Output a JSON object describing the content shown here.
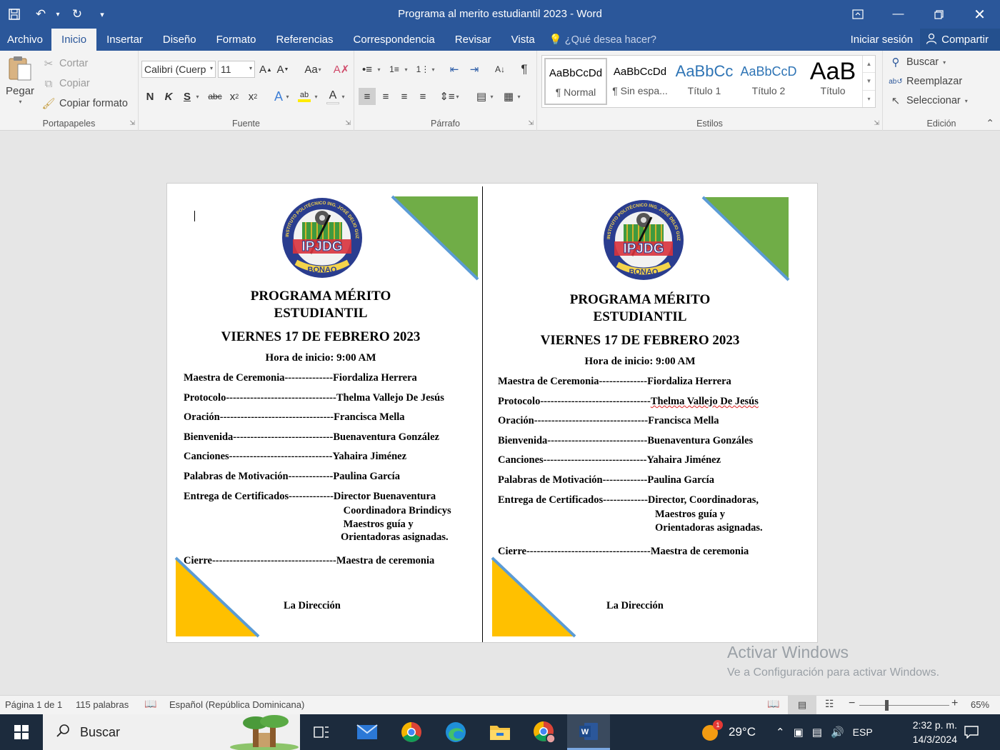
{
  "window": {
    "title": "Programa al merito estudiantil 2023 - Word"
  },
  "tabs": [
    "Archivo",
    "Inicio",
    "Insertar",
    "Diseño",
    "Formato",
    "Referencias",
    "Correspondencia",
    "Revisar",
    "Vista"
  ],
  "active_tab": "Inicio",
  "tell_me": "¿Qué desea hacer?",
  "sign_in": "Iniciar sesión",
  "share": "Compartir",
  "clipboard": {
    "label": "Portapapeles",
    "paste": "Pegar",
    "cut": "Cortar",
    "copy": "Copiar",
    "format_painter": "Copiar formato"
  },
  "font": {
    "label": "Fuente",
    "name": "Calibri (Cuerp",
    "size": "11"
  },
  "paragraph": {
    "label": "Párrafo"
  },
  "styles": {
    "label": "Estilos",
    "items": [
      {
        "sample": "AaBbCcDd",
        "name": "¶ Normal"
      },
      {
        "sample": "AaBbCcDd",
        "name": "¶ Sin espa..."
      },
      {
        "sample": "AaBbCc",
        "name": "Título 1"
      },
      {
        "sample": "AaBbCcD",
        "name": "Título 2"
      },
      {
        "sample": "AaB",
        "name": "Título"
      }
    ]
  },
  "editing": {
    "label": "Edición",
    "find": "Buscar",
    "replace": "Reemplazar",
    "select": "Seleccionar"
  },
  "document": {
    "left": {
      "title_line1": "PROGRAMA MÉRITO",
      "title_line2": "ESTUDIANTIL",
      "date": "VIERNES 17 DE FEBRERO 2023",
      "start_time": "Hora de inicio: 9:00 AM",
      "rows": [
        {
          "role": "Maestra de Ceremonia--------------",
          "person": "Fiordaliza Herrera"
        },
        {
          "role": "Protocolo--------------------------------",
          "person": "Thelma Vallejo De Jesús"
        },
        {
          "role": "Oración---------------------------------",
          "person": "Francisca Mella"
        },
        {
          "role": "Bienvenida-----------------------------",
          "person": "Buenaventura González"
        },
        {
          "role": "Canciones------------------------------",
          "person": "Yahaira Jiménez"
        },
        {
          "role": "Palabras de Motivación-------------",
          "person": "Paulina García"
        },
        {
          "role": "Entrega de Certificados-------------",
          "person": "Director Buenaventura"
        }
      ],
      "cert_extra": [
        " Coordinadora Brindicys",
        " Maestros guía y",
        "Orientadoras asignadas."
      ],
      "closing": {
        "role": "Cierre------------------------------------",
        "person": "Maestra de ceremonia"
      },
      "signature": "La Dirección"
    },
    "right": {
      "title_line1": "PROGRAMA MÉRITO",
      "title_line2": "ESTUDIANTIL",
      "date": "VIERNES 17 DE FEBRERO 2023",
      "start_time": "Hora de inicio: 9:00 AM",
      "rows": [
        {
          "role": "Maestra de Ceremonia--------------",
          "person": "Fiordaliza Herrera"
        },
        {
          "role": "Protocolo--------------------------------",
          "person": "Thelma Vallejo De Jesús"
        },
        {
          "role": "Oración---------------------------------",
          "person": "Francisca Mella"
        },
        {
          "role": "Bienvenida-----------------------------",
          "person": "Buenaventura Gonzáles"
        },
        {
          "role": "Canciones------------------------------",
          "person": "Yahaira Jiménez"
        },
        {
          "role": "Palabras de Motivación-------------",
          "person": "Paulina García"
        },
        {
          "role": "Entrega de Certificados-------------",
          "person": "Director, Coordinadoras,"
        }
      ],
      "cert_extra": [
        "Maestros guía y",
        "Orientadoras asignadas."
      ],
      "closing": {
        "role": "Cierre------------------------------------",
        "person": "Maestra de ceremonia"
      },
      "signature": "La Dirección"
    },
    "logo": {
      "ring_text": "INSTITUTO POLITÉCNICO ING. JOSÉ DELIO GUZMÁN",
      "initials": "IPJDG",
      "city": "BONAO"
    }
  },
  "watermark": {
    "line1": "Activar Windows",
    "line2": "Ve a Configuración para activar Windows."
  },
  "status": {
    "page": "Página 1 de 1",
    "words": "115 palabras",
    "language": "Español (República Dominicana)",
    "zoom": "65%"
  },
  "taskbar": {
    "search": "Buscar",
    "temperature": "29°C",
    "weather_badge": "1",
    "lang": "ESP",
    "time": "2:32 p. m.",
    "date": "14/3/2024"
  },
  "colors": {
    "word_blue": "#2b579a",
    "green_triangle": "#70ad47",
    "yellow_triangle": "#ffc000",
    "triangle_edge": "#5b9bd5"
  }
}
